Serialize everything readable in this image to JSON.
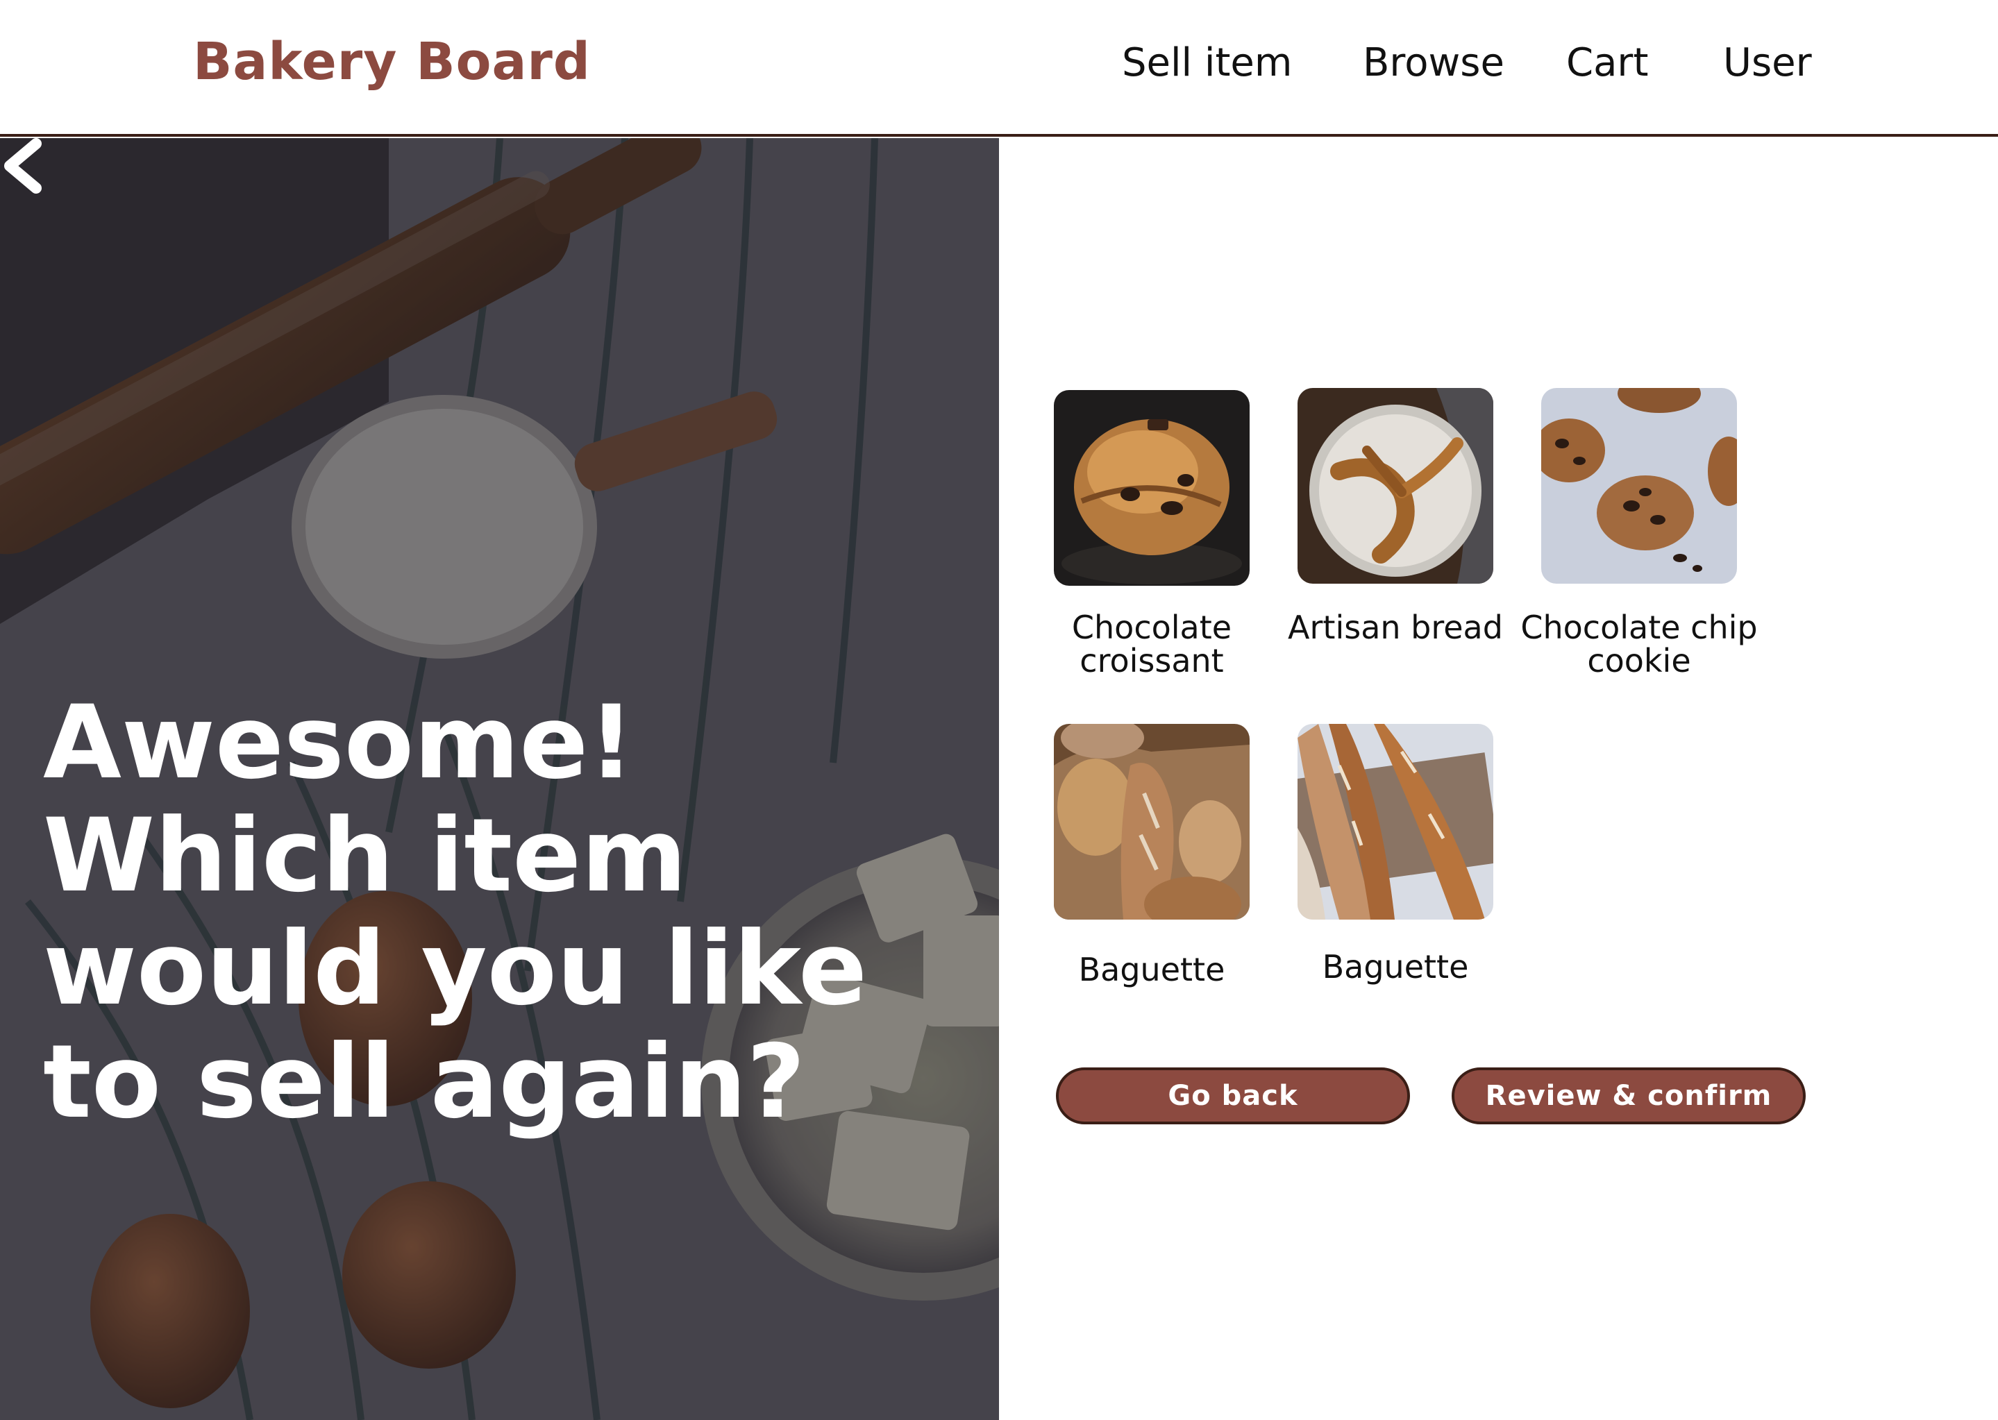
{
  "header": {
    "brand": "Bakery Board",
    "nav": [
      "Sell item",
      "Browse",
      "Cart",
      "User"
    ]
  },
  "hero": {
    "back_icon": "chevron-left-icon",
    "title": "Awesome! Which item would you like to sell again?"
  },
  "items": [
    {
      "label": "Chocolate croissant",
      "image": "chocolate-croissant-photo"
    },
    {
      "label": "Artisan bread",
      "image": "artisan-bread-photo"
    },
    {
      "label": "Chocolate chip cookie",
      "image": "chocolate-chip-cookie-photo"
    },
    {
      "label": "Baguette",
      "image": "baguette-bag-photo"
    },
    {
      "label": "Baguette",
      "image": "baguette-board-photo"
    }
  ],
  "buttons": {
    "go_back": "Go back",
    "review_confirm": "Review & confirm"
  },
  "colors": {
    "brand": "#8c4a40",
    "button_bg": "#8c4a40",
    "button_border": "#3a1e16",
    "header_border": "#3a1e16"
  }
}
